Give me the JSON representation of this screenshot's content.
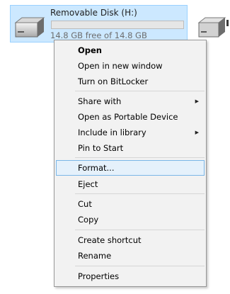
{
  "drive": {
    "name": "Removable Disk (H:)",
    "free_text": "14.8 GB free of 14.8 GB",
    "used_fraction": 0.0
  },
  "menu": {
    "open": "Open",
    "open_new_window": "Open in new window",
    "bitlocker": "Turn on BitLocker",
    "share_with": "Share with",
    "portable": "Open as Portable Device",
    "include_library": "Include in library",
    "pin_start": "Pin to Start",
    "format": "Format...",
    "eject": "Eject",
    "cut": "Cut",
    "copy": "Copy",
    "create_shortcut": "Create shortcut",
    "rename": "Rename",
    "properties": "Properties"
  },
  "colors": {
    "selection": "#cce8ff",
    "hover_border": "#7ab6e7",
    "menu_bg": "#f2f2f2"
  }
}
